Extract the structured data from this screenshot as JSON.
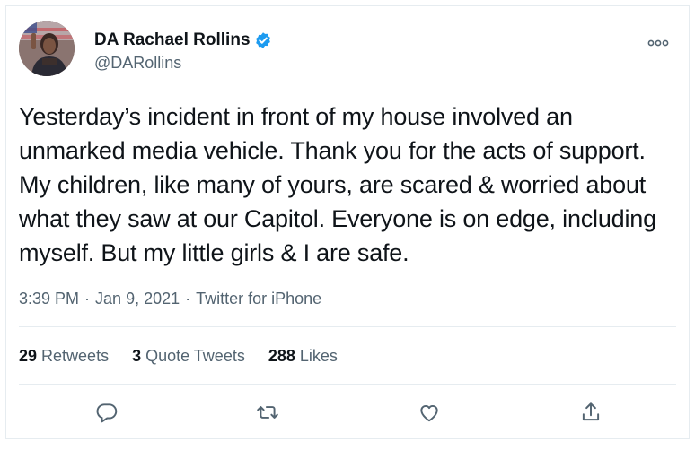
{
  "author": {
    "display_name": "DA Rachael Rollins",
    "handle": "@DARollins",
    "verified": true,
    "avatar_icon": "profile-photo"
  },
  "tweet": {
    "text": "Yesterday’s incident in front of my house involved an unmarked media vehicle. Thank you for the acts of support. My children, like many of yours, are scared & worried about what they saw at our Capitol. Everyone is on edge, including myself. But my little girls & I are safe.",
    "time": "3:39 PM",
    "date": "Jan 9, 2021",
    "source": "Twitter for iPhone",
    "separator": "·"
  },
  "stats": {
    "retweets": {
      "count": "29",
      "label": "Retweets"
    },
    "quotes": {
      "count": "3",
      "label": "Quote Tweets"
    },
    "likes": {
      "count": "288",
      "label": "Likes"
    }
  },
  "actions": [
    {
      "name": "reply",
      "icon": "reply-icon"
    },
    {
      "name": "retweet",
      "icon": "retweet-icon"
    },
    {
      "name": "like",
      "icon": "like-icon"
    },
    {
      "name": "share",
      "icon": "share-icon"
    }
  ],
  "colors": {
    "verified_blue": "#1d9bf0",
    "secondary_text": "#536471",
    "divider": "#e6ecf0"
  }
}
